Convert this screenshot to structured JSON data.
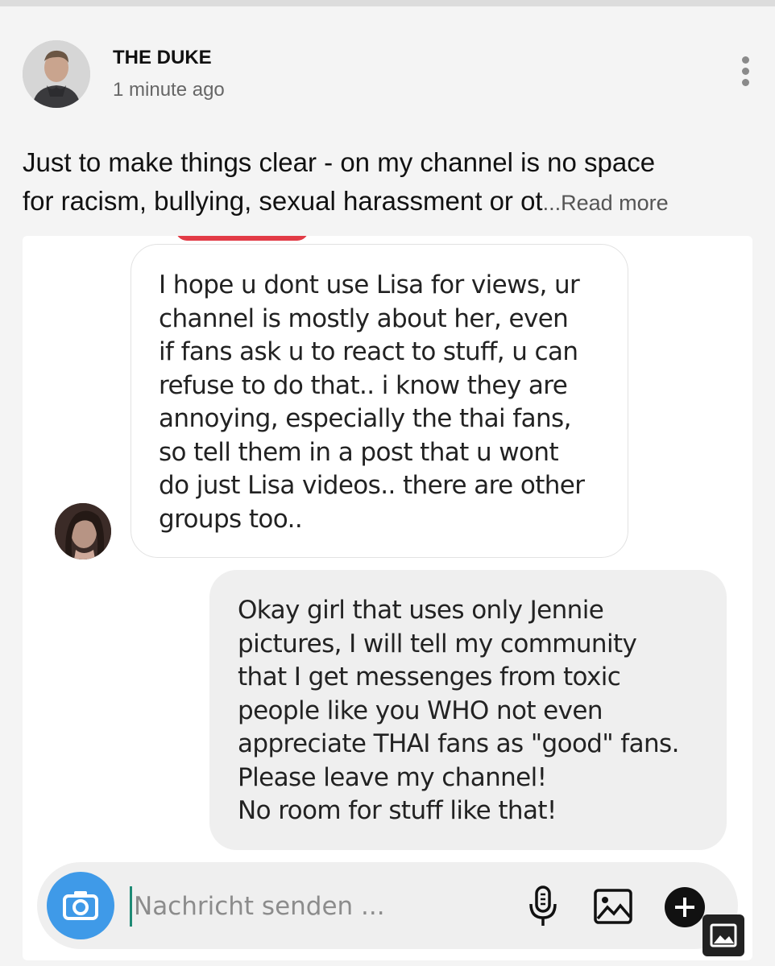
{
  "post": {
    "author": "THE DUKE",
    "time": "1 minute ago",
    "text_lines": [
      "Just to make things clear - on my channel is no space",
      "for racism, bullying, sexual harassment or ot"
    ],
    "read_more": "...Read more"
  },
  "conversation": {
    "incoming_lines": [
      "I hope u dont use Lisa for views, ur",
      "channel is mostly about her, even",
      "if fans ask u to react to stuff, u can",
      "refuse to do that.. i know they are",
      "annoying, especially the thai fans,",
      "so tell them in a post that u wont",
      "do just Lisa videos.. there are other",
      "groups too.."
    ],
    "outgoing_lines": [
      "Okay girl that uses only Jennie",
      "pictures, I will tell my community",
      "that I get messenges from toxic",
      "people like you WHO not even",
      "appreciate THAI fans as \"good\" fans.",
      "Please leave my channel!",
      "No room for stuff like that!"
    ]
  },
  "composer": {
    "placeholder": "Nachricht senden ..."
  },
  "colors": {
    "camera_button": "#3f9ae8",
    "highlight_mark": "#e23b46",
    "cursor": "#1f8a75"
  },
  "icons": [
    "more-vertical-icon",
    "camera-icon",
    "microphone-icon",
    "image-icon",
    "plus-icon"
  ]
}
